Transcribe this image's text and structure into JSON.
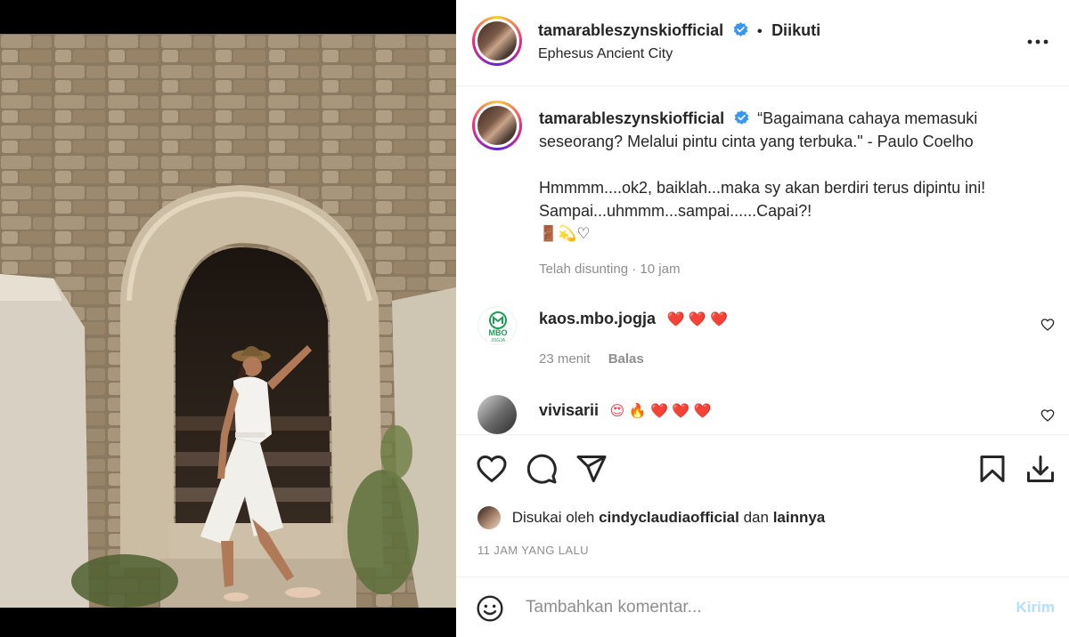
{
  "post": {
    "username": "tamarableszynskiofficial",
    "follow_status": "Diikuti",
    "location": "Ephesus Ancient City",
    "more_icon": "more-horizontal-icon"
  },
  "caption": {
    "username": "tamarableszynskiofficial",
    "line1": "“Bagaimana cahaya memasuki",
    "line2": "seseorang? Melalui pintu cinta yang terbuka.\" - Paulo Coelho",
    "line3": "Hmmmm....ok2, baiklah...maka sy akan berdiri terus dipintu ini!",
    "line4": "Sampai...uhmmm...sampai......Capai?!",
    "emojis": "🚪💫♡",
    "edited": "Telah disunting",
    "separator": "·",
    "time": "10 jam"
  },
  "comments": [
    {
      "username": "kaos.mbo.jogja",
      "text": "❤️ ❤️ ❤️",
      "avatar_text": "MBO",
      "avatar_sub": "JOGJA",
      "time": "23 menit",
      "reply_label": "Balas"
    },
    {
      "username": "vivisarii",
      "text": "😍 🔥 ❤️ ❤️ ❤️"
    }
  ],
  "actions": {
    "liked_prefix": "Disukai oleh",
    "liked_user": "cindyclaudiaofficial",
    "liked_and": "dan",
    "liked_others": "lainnya",
    "timestamp": "11 JAM YANG LALU"
  },
  "add_comment": {
    "placeholder": "Tambahkan komentar...",
    "send_label": "Kirim"
  },
  "colors": {
    "verified": "#3897f0",
    "heart_red": "#ed4956",
    "send_disabled": "#b2dffc",
    "secondary_text": "#8e8e8e"
  }
}
